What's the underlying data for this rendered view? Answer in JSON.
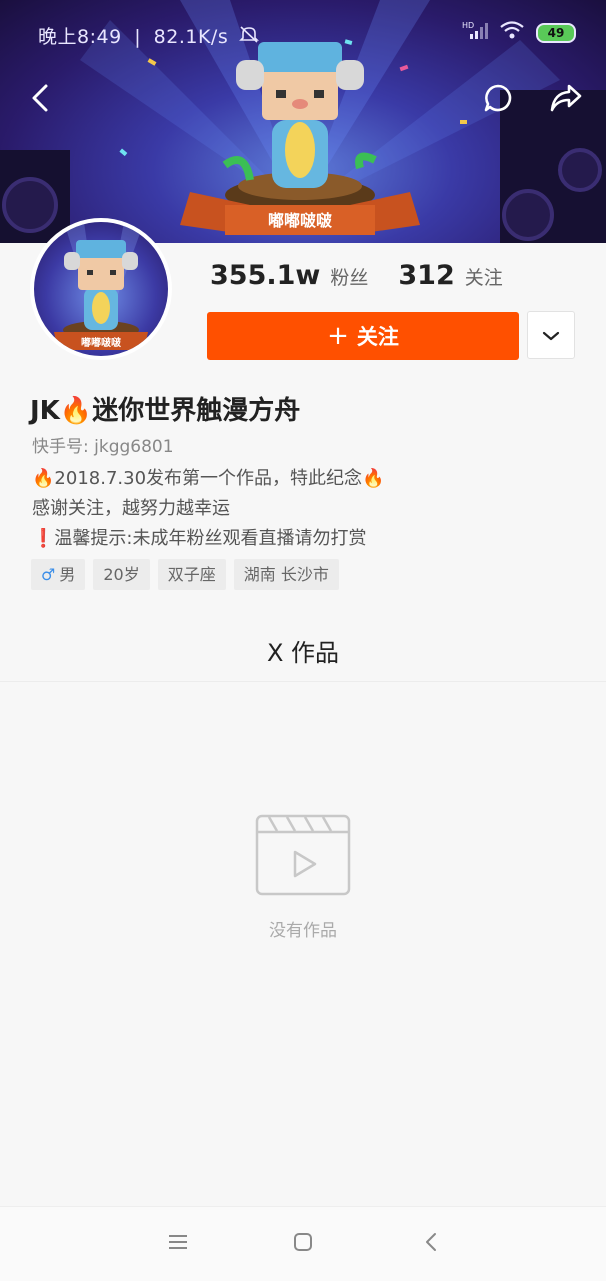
{
  "status_bar": {
    "time": "晚上8:49",
    "separator": "|",
    "speed": "82.1K/s",
    "signal_label": "HD",
    "battery": "49"
  },
  "banner": {
    "character_label": "嘟嘟啵啵"
  },
  "avatar": {
    "character_label": "嘟嘟啵啵"
  },
  "stats": {
    "fans_count": "355.1w",
    "fans_label": "粉丝",
    "following_count": "312",
    "following_label": "关注"
  },
  "follow_button": {
    "plus": "+",
    "label": "关注"
  },
  "profile": {
    "name": "JK🔥迷你世界触漫方舟",
    "kuaishou_id": "快手号: jkgg6801",
    "bio_lines": [
      "🔥2018.7.30发布第一个作品，特此纪念🔥",
      "感谢关注，越努力越幸运",
      "❗温馨提示:未成年粉丝观看直播请勿打赏"
    ],
    "tags": {
      "gender_symbol": "♂",
      "gender": "男",
      "age": "20岁",
      "zodiac": "双子座",
      "location": "湖南 长沙市"
    }
  },
  "tab": {
    "label": "X 作品"
  },
  "empty_state": {
    "text": "没有作品"
  },
  "colors": {
    "accent": "#ff5000",
    "male": "#3b8ee8"
  }
}
